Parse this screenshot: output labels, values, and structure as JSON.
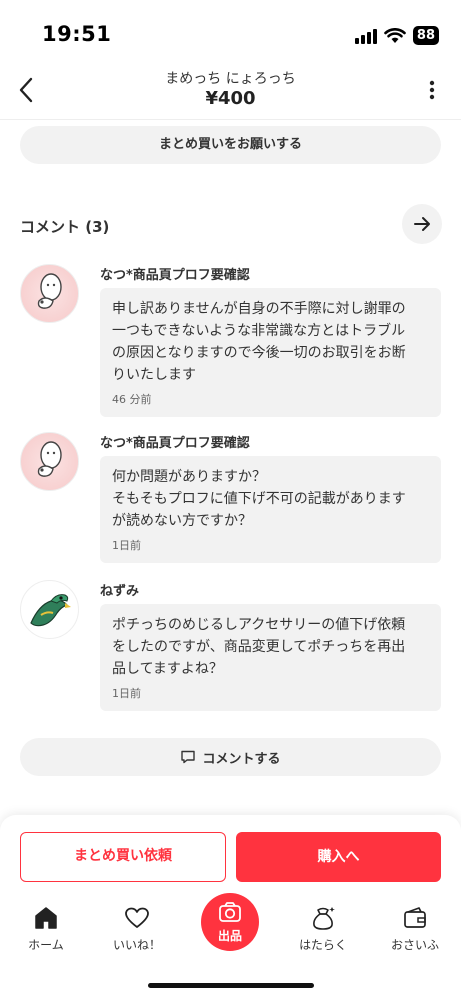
{
  "status": {
    "time": "19:51",
    "battery": "88"
  },
  "header": {
    "title": "まめっち にょろっち",
    "price": "¥400"
  },
  "bulk_request_label": "まとめ買いをお願いする",
  "comments_heading": "コメント (3)",
  "comments": [
    {
      "name": "なつ*商品頁プロフ要確認",
      "text": "申し訳ありませんが自身の不手際に対し謝罪の\n一つもできないような非常識な方とはトラブル\nの原因となりますので今後一切のお取引をお断\nりいたします",
      "time": "46 分前"
    },
    {
      "name": "なつ*商品頁プロフ要確認",
      "text": "何か問題がありますか？\nそもそもプロフに値下げ不可の記載があります\nが読めない方ですか？",
      "time": "1日前"
    },
    {
      "name": "ねずみ",
      "text": "ポチっちのめじるしアクセサリーの値下げ依頼\nをしたのですが、商品変更してポチっちを再出\n品してますよね？",
      "time": "1日前"
    }
  ],
  "comment_button_label": "コメントする",
  "actions": {
    "bulk_order": "まとめ買い依頼",
    "buy": "購入へ"
  },
  "tabs": [
    {
      "label": "ホーム",
      "icon": "home-icon"
    },
    {
      "label": "いいね！",
      "icon": "heart-icon"
    },
    {
      "label": "出品",
      "icon": "camera-icon"
    },
    {
      "label": "はたらく",
      "icon": "money-bag-icon"
    },
    {
      "label": "おさいふ",
      "icon": "wallet-icon"
    }
  ],
  "colors": {
    "accent": "#ff333f",
    "surface": "#f2f2f2"
  }
}
